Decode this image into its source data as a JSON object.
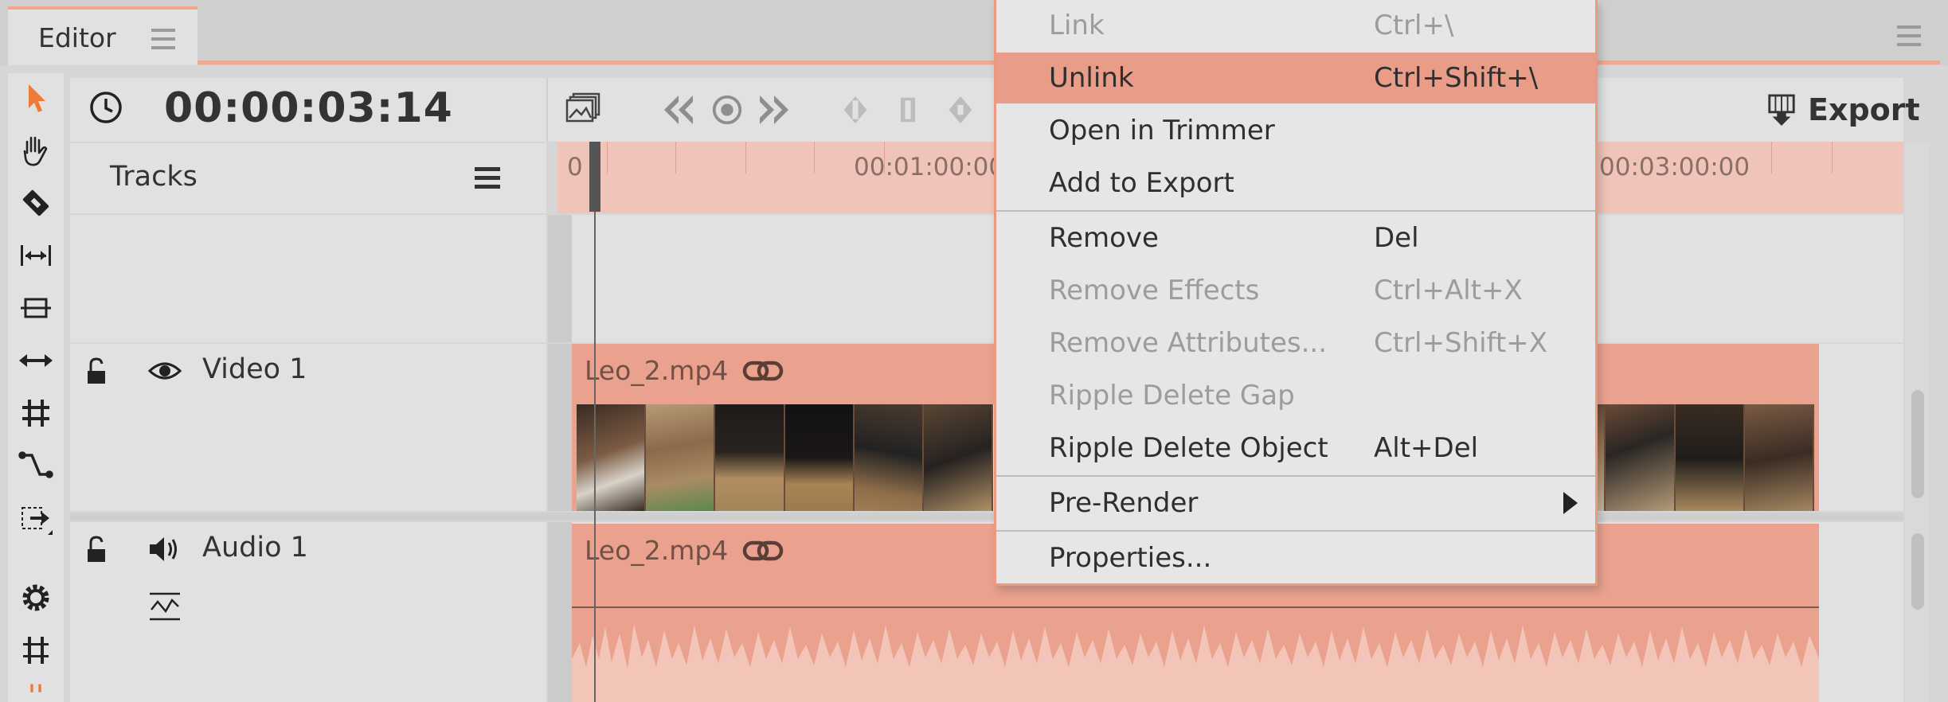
{
  "tab": {
    "label": "Editor"
  },
  "header": {
    "timecode": "00:00:03:14",
    "export_label": "Export"
  },
  "tracks": {
    "label": "Tracks"
  },
  "ruler": {
    "labels": [
      "0",
      "00:01:00:00",
      "00:03:00:00"
    ]
  },
  "video_track": {
    "name": "Video 1",
    "clip_name": "Leo_2.mp4"
  },
  "audio_track": {
    "name": "Audio 1",
    "clip_name": "Leo_2.mp4"
  },
  "context_menu": {
    "items": [
      {
        "label": "Link",
        "shortcut": "Ctrl+\\",
        "disabled": true
      },
      {
        "label": "Unlink",
        "shortcut": "Ctrl+Shift+\\",
        "highlighted": true
      },
      {
        "label": "Open in Trimmer",
        "shortcut": ""
      },
      {
        "label": "Add to Export",
        "shortcut": ""
      },
      {
        "label": "Remove",
        "shortcut": "Del"
      },
      {
        "label": "Remove Effects",
        "shortcut": "Ctrl+Alt+X",
        "disabled": true
      },
      {
        "label": "Remove Attributes...",
        "shortcut": "Ctrl+Shift+X",
        "disabled": true
      },
      {
        "label": "Ripple Delete Gap",
        "shortcut": "",
        "disabled": true
      },
      {
        "label": "Ripple Delete Object",
        "shortcut": "Alt+Del"
      },
      {
        "label": "Pre-Render",
        "shortcut": "",
        "submenu": true
      },
      {
        "label": "Properties...",
        "shortcut": ""
      }
    ]
  },
  "icons": {
    "toolbar": [
      "pointer-icon",
      "hand-icon",
      "razor-icon",
      "ripple-icon",
      "lift-icon",
      "slip-icon",
      "grid-icon",
      "curve-icon",
      "select-track-icon",
      "gear-icon",
      "snap-icon"
    ]
  },
  "colors": {
    "accent": "#ee7a4e",
    "clip": "#eaa28f",
    "highlight": "#e99c87",
    "ruler": "#f0c4b9"
  }
}
